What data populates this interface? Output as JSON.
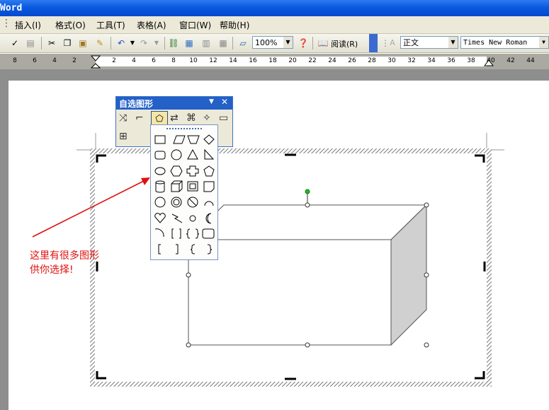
{
  "window": {
    "title": "Word"
  },
  "menubar": {
    "items": [
      "插入(I)",
      "格式(O)",
      "工具(T)",
      "表格(A)",
      "窗口(W)",
      "帮助(H)"
    ]
  },
  "toolbar": {
    "zoom": "100%",
    "read_label": "阅读(R)",
    "style": "正文",
    "font": "Times New Roman"
  },
  "ruler": {
    "ticks": [
      "8",
      "6",
      "4",
      "2",
      "2",
      "4",
      "6",
      "8",
      "10",
      "12",
      "14",
      "16",
      "18",
      "20",
      "22",
      "24",
      "26",
      "28",
      "30",
      "32",
      "34",
      "36",
      "38",
      "40",
      "42",
      "44"
    ]
  },
  "autoshapes": {
    "title": "自选图形"
  },
  "annotation": {
    "line1": "这里有很多图形",
    "line2": "供你选择!"
  },
  "colors": {
    "titlebar": "#0a5ae0",
    "menubar": "#ece9d8",
    "annotation": "#e01010",
    "rotate_handle": "#22bb22"
  }
}
